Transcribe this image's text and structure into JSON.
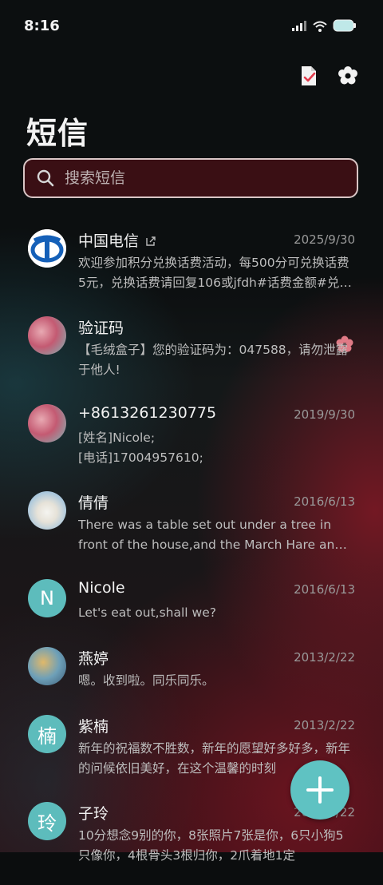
{
  "status_bar": {
    "time": "8:16"
  },
  "header": {
    "title": "短信"
  },
  "search": {
    "placeholder": "搜索短信"
  },
  "colors": {
    "accent": "#5fc2c2",
    "search_bg": "#3a0f14"
  },
  "icons": {
    "toolbar": [
      "document-check-icon",
      "settings-flower-icon"
    ],
    "fab": "plus-icon"
  },
  "conversations": [
    {
      "name": "中国电信",
      "date": "2025/9/30",
      "message": "欢迎参加积分兑换话费活动，每500分可兑换话费5元，兑换话费请回复106或jfdh#话费金额#兑换码，详情请查询"
    },
    {
      "name": "验证码",
      "date": "",
      "message": "【毛绒盒子】您的验证码为：047588，请勿泄露于他人!"
    },
    {
      "name": "+8613261230775",
      "date": "2019/9/30",
      "message": "[姓名]Nicole;\n[电话]17004957610;"
    },
    {
      "name": "倩倩",
      "date": "2016/6/13",
      "message": "There was a table set out under a tree in front of the house,and the March Hare and the Hatter were having tea"
    },
    {
      "name": "Nicole",
      "date": "2016/6/13",
      "message": "Let's eat out,shall we?",
      "initial": "N"
    },
    {
      "name": "燕婷",
      "date": "2013/2/22",
      "message": "嗯。收到啦。同乐同乐。"
    },
    {
      "name": "紫楠",
      "date": "2013/2/22",
      "message": "新年的祝福数不胜数，新年的愿望好多好多，新年的问候依旧美好，在这个温馨的时刻",
      "initial": "楠"
    },
    {
      "name": "子玲",
      "date": "2013/2/22",
      "message": "10分想念9别的你，8张照片7张是你，6只小狗5只像你，4根骨头3根归你，2爪着地1定",
      "initial": "玲"
    }
  ]
}
